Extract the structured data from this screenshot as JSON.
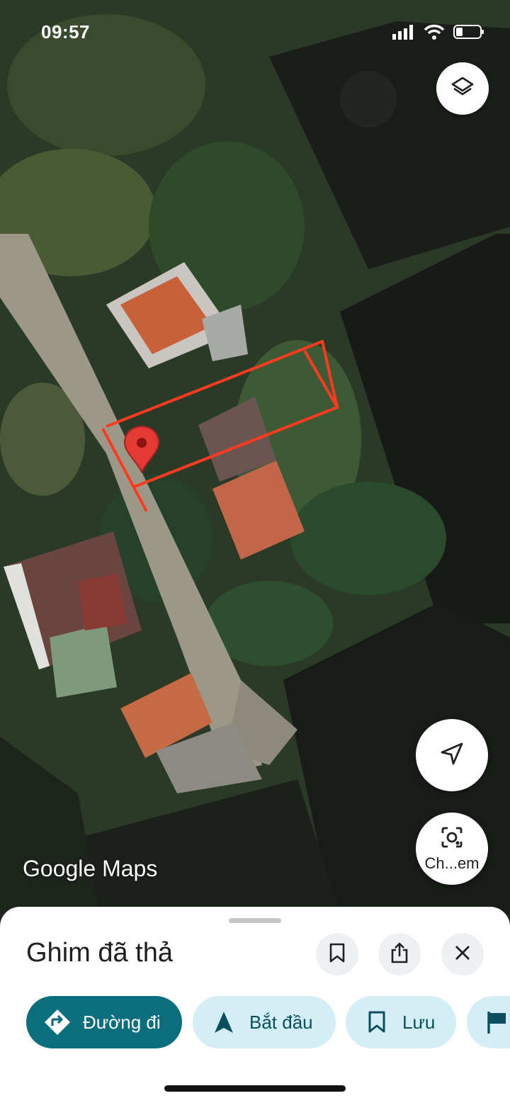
{
  "status_bar": {
    "time": "09:57"
  },
  "map": {
    "attribution": "Google Maps",
    "pin_color": "#e53935",
    "boundary_color": "#ff3b1f"
  },
  "map_buttons": {
    "lens_label": "Ch...em"
  },
  "sheet": {
    "title": "Ghim đã thả"
  },
  "chips": {
    "directions": "Đường đi",
    "start": "Bắt đầu",
    "save": "Lưu"
  },
  "colors": {
    "accent": "#0b6e7d",
    "chip_bg": "#d3eef5"
  }
}
